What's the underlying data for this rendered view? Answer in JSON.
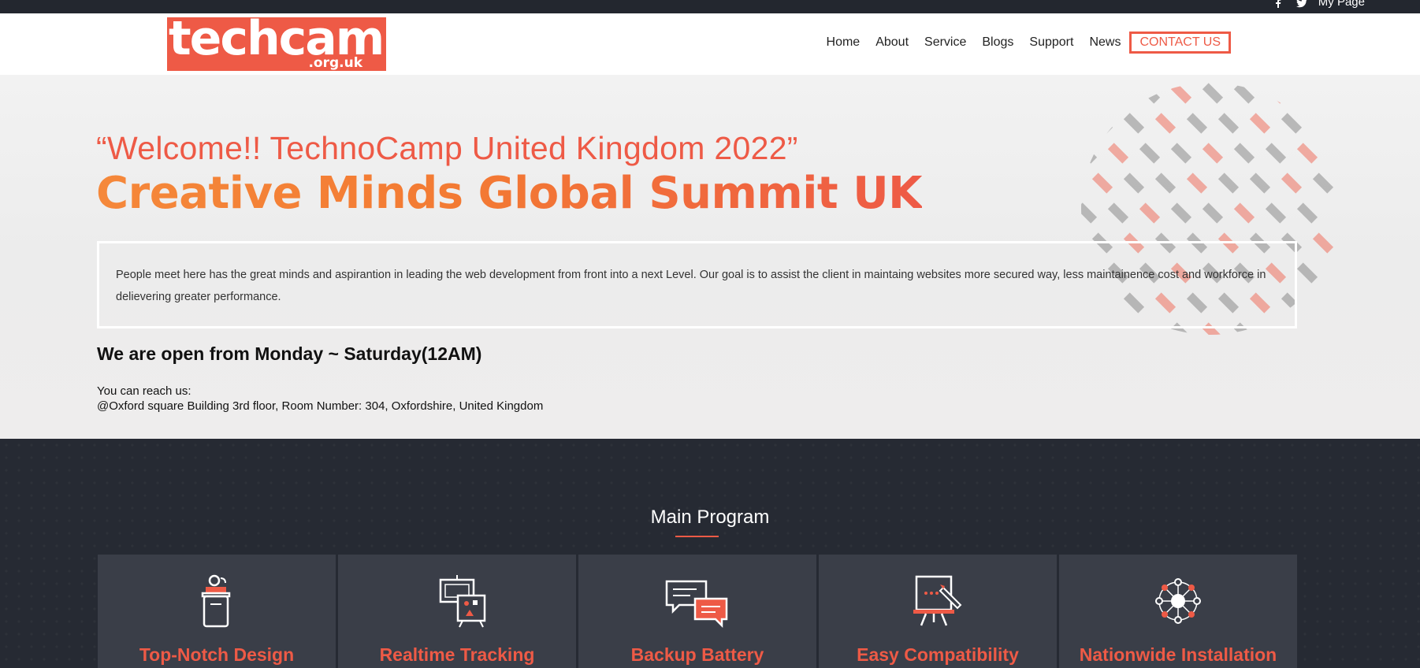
{
  "topbar": {
    "mypage_label": "My Page",
    "social_icons": [
      "facebook-icon",
      "twitter-icon"
    ]
  },
  "header": {
    "logo_text": "techcamp",
    "logo_sub": ".org.uk",
    "nav": [
      {
        "label": "Home"
      },
      {
        "label": "About"
      },
      {
        "label": "Service"
      },
      {
        "label": "Blogs"
      },
      {
        "label": "Support"
      },
      {
        "label": "News"
      },
      {
        "label": "CONTACT US"
      }
    ]
  },
  "hero": {
    "welcome": "“Welcome!! TechnoCamp United Kingdom 2022”",
    "summit": "Creative Minds Global Summit UK",
    "intro": "People meet here has the great minds and aspirantion in leading the web development from front into a next Level. Our goal is to assist the client in maintaing websites more secured way, less maintainence cost and workforce in delievering greater performance.",
    "open_hours": "We are open from Monday ~ Saturday(12AM)",
    "reach_label": "You can reach us:",
    "address": "@Oxford square Building 3rd floor, Room Number: 304, Oxfordshire, United Kingdom"
  },
  "program": {
    "title": "Main Program",
    "cards": [
      {
        "label": "Top-Notch Design",
        "icon": "podium-icon"
      },
      {
        "label": "Realtime Tracking",
        "icon": "presentation-board-icon"
      },
      {
        "label": "Backup Battery",
        "icon": "chat-bubbles-icon"
      },
      {
        "label": "Easy Compatibility",
        "icon": "easel-pen-icon"
      },
      {
        "label": "Nationwide Installation",
        "icon": "network-icon"
      }
    ]
  },
  "colors": {
    "accent": "#ee5a46",
    "dark": "#262a33",
    "card": "#3a3e48",
    "orange": "#f3792f"
  }
}
